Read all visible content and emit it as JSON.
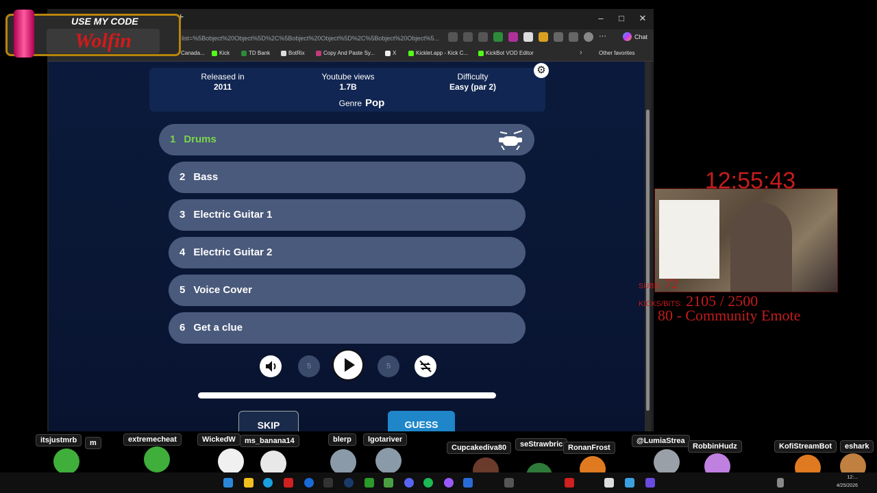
{
  "browser": {
    "url": "list=%5Bobject%20Object%5D%2C%5Bobject%20Object%5D%2C%5Bobject%20Object%5...",
    "chat_label": "Chat",
    "bookmarks": [
      "Canada...",
      "Kick",
      "TD Bank",
      "BotRix",
      "Copy And Paste Sy...",
      "X",
      "Kicklet.app - Kick C...",
      "KickBot VOD Editor"
    ],
    "other_favorites": "Other favorites"
  },
  "song_info": {
    "released_label": "Released in",
    "released_value": "2011",
    "views_label": "Youtube views",
    "views_value": "1.7B",
    "difficulty_label": "Difficulty",
    "difficulty_value": "Easy (par 2)",
    "genre_label": "Genre",
    "genre_value": "Pop"
  },
  "tracks": [
    {
      "num": "1",
      "label": "Drums"
    },
    {
      "num": "2",
      "label": "Bass"
    },
    {
      "num": "3",
      "label": "Electric Guitar 1"
    },
    {
      "num": "4",
      "label": "Electric Guitar 2"
    },
    {
      "num": "5",
      "label": "Voice Cover"
    },
    {
      "num": "6",
      "label": "Get a clue"
    }
  ],
  "player": {
    "rewind_label": "5",
    "forward_label": "5",
    "progress": 1.0
  },
  "actions": {
    "skip": "SKIP",
    "guess": "GUESS"
  },
  "overlay": {
    "use_code": "USE MY CODE",
    "brand": "Wolfin",
    "clock": "12:55:43",
    "subs_label": "SUBS:",
    "subs_value": "72",
    "kicks_label": "KICKS/BITS:",
    "kicks_value": "2105 / 2500",
    "goal": "80 - Community Emote"
  },
  "chatters": [
    "itsjustmrb",
    "m",
    "extremecheat",
    "WickedW",
    "ms_banana14",
    "blerp",
    "lgotariver",
    "Cupcakediva80",
    "seStrawbric",
    "RonanFrost",
    "@LumiaStrea",
    "RobbinHudz",
    "KofiStreamBot",
    "eshark"
  ],
  "taskbar": {
    "time": "12:...",
    "date": "4/25/2026"
  },
  "colors": {
    "page_bg": "#0b1a3c",
    "track_bg": "#4a5a7c",
    "active_track_text": "#7cd64a",
    "guess_bg": "#1e86c9",
    "overlay_red": "#c41c1c"
  }
}
